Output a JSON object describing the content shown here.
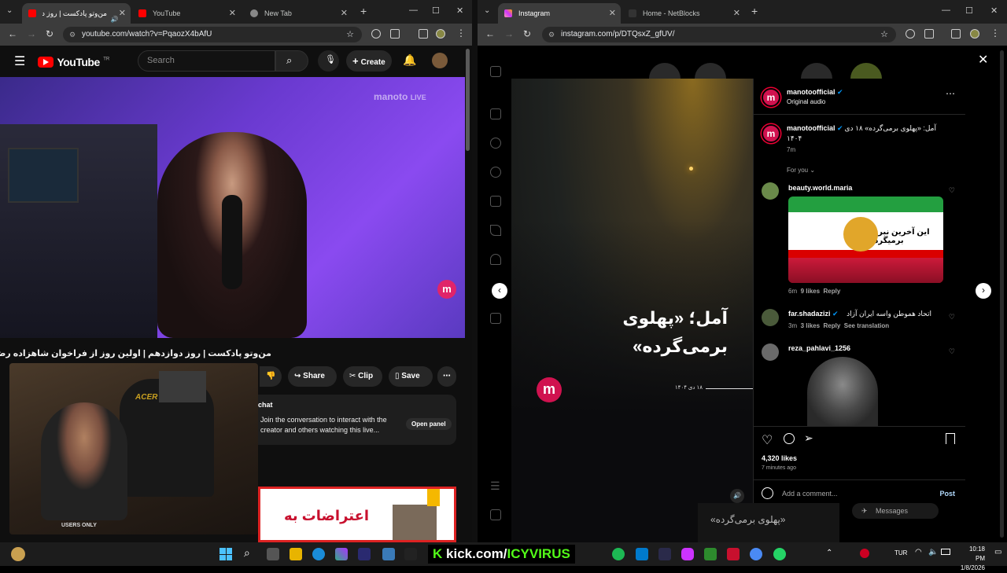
{
  "left_window": {
    "tabs": [
      {
        "label": "من‌وتو پادکست | روز دوا"
      },
      {
        "label": "YouTube"
      },
      {
        "label": "New Tab"
      }
    ],
    "url": "youtube.com/watch?v=PqaozX4bAfU"
  },
  "youtube": {
    "logo": "YouTube",
    "logo_sup": "TR",
    "search_placeholder": "Search",
    "create_label": "Create",
    "watermark": "manoto",
    "watermark_live": "LIVE",
    "video_title": "من‌وتو پادکست | روز دوازدهم | اولین روز از فراخوان شاهزاده رضا پهلوی",
    "actions": {
      "share": "Share",
      "clip": "Clip",
      "save": "Save"
    },
    "chat": {
      "header": "chat",
      "message": "Join the conversation to interact with the creator and others watching this live...",
      "open_panel": "Open panel"
    },
    "promo_text": "اعتراضات به",
    "cam_label": "USERS ONLY"
  },
  "right_window": {
    "tabs": [
      {
        "label": "Instagram"
      },
      {
        "label": "Home - NetBlocks"
      }
    ],
    "url": "instagram.com/p/DTQsxZ_gfUV/"
  },
  "instagram": {
    "reel_caption_line1": "آمل؛ «پهلوی",
    "reel_caption_line2": "برمی‌گرده»",
    "reel_date": "۱۸ دی ۱۴۰۴",
    "owner": "manotoofficial",
    "audio": "Original audio",
    "caption_user": "manotoofficial",
    "caption_text": "آمل: «پهلوی برمی‌گرده» ۱۸ دی",
    "caption_text2": "۱۴۰۴",
    "caption_time": "7m",
    "filter": "For you",
    "comments": [
      {
        "user": "beauty.world.maria",
        "text": "",
        "time": "6m",
        "likes": "9 likes",
        "reply": "Reply",
        "image_caption": "این آخرین نبرده  پهلوی برمیگرده"
      },
      {
        "user": "far.shadazizi",
        "text": "اتحاد هموطن واسه ایران آزاد",
        "time": "3m",
        "likes": "3 likes",
        "reply": "Reply",
        "translate": "See translation"
      },
      {
        "user": "reza_pahlavi_1256",
        "text": "",
        "time": "",
        "likes": "",
        "reply": ""
      }
    ],
    "likes": "4,320 likes",
    "posted": "7 minutes ago",
    "add_comment": "Add a comment...",
    "post": "Post",
    "messages": "Messages",
    "bottom_caption": "«پهلوی برمی‌گرده»"
  },
  "taskbar": {
    "kick_text": "kick.com/",
    "kick_user": "ICYVIRUS",
    "lang": "TUR",
    "time": "10:18 PM",
    "date": "1/8/2026"
  },
  "colors": {
    "yt_red": "#ff0000",
    "kick_green": "#53fc18",
    "manoto_red": "#d0124f"
  }
}
